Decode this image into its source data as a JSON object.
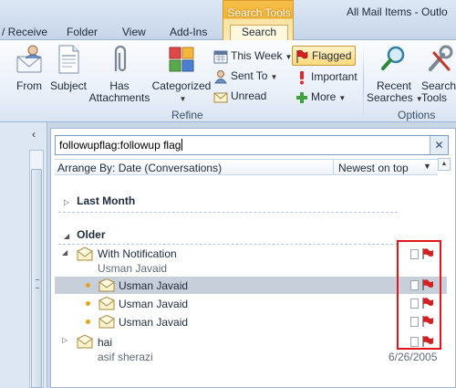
{
  "window": {
    "title": "All Mail Items - Outlo"
  },
  "context_tab_group": "Search Tools",
  "tabs": [
    {
      "label": "/ Receive"
    },
    {
      "label": "Folder"
    },
    {
      "label": "View"
    },
    {
      "label": "Add-Ins"
    },
    {
      "label": "Search"
    }
  ],
  "ribbon": {
    "refine": {
      "title": "Refine",
      "from": "From",
      "subject": "Subject",
      "has_attachments_1": "Has",
      "has_attachments_2": "Attachments",
      "categorized": "Categorized",
      "this_week": "This Week",
      "sent_to": "Sent To",
      "unread": "Unread",
      "flagged": "Flagged",
      "important": "Important",
      "more": "More"
    },
    "options": {
      "title": "Options",
      "recent_searches_1": "Recent",
      "recent_searches_2": "Searches",
      "search_tools_1": "Search",
      "search_tools_2": "Tools"
    }
  },
  "search": {
    "query": "followupflag:followup flag",
    "clear": "✕"
  },
  "arrange": {
    "label": "Arrange By: Date (Conversations)",
    "order": "Newest on top"
  },
  "groups": [
    {
      "label": "Last Month"
    },
    {
      "label": "Older"
    }
  ],
  "messages": {
    "conversation": {
      "subject": "With Notification",
      "sender": "Usman Javaid"
    },
    "children": [
      {
        "sender": "Usman Javaid"
      },
      {
        "sender": "Usman Javaid"
      },
      {
        "sender": "Usman Javaid"
      }
    ],
    "second": {
      "subject": "hai",
      "sender": "asif sherazi",
      "date": "6/26/2005"
    }
  },
  "colors": {
    "accent": "#f2b134",
    "flag": "#d42020",
    "highlight": "#e3151b",
    "selection": "#c7cfda"
  }
}
